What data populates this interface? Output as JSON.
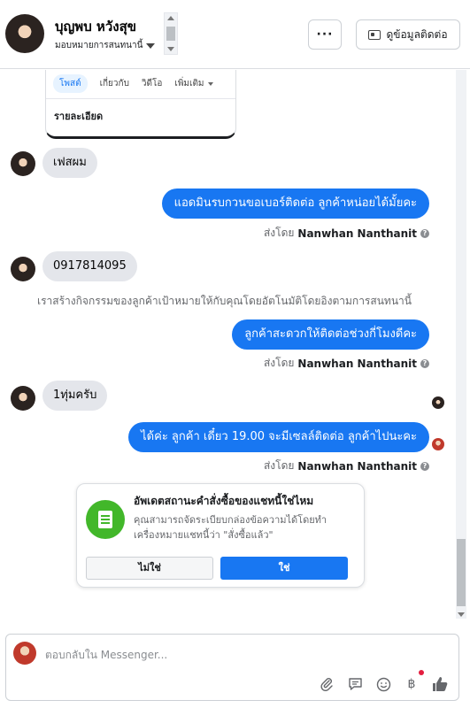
{
  "header": {
    "name": "บุญพบ หวังสุข",
    "assign_label": "มอบหมายการสนทนานี้",
    "more_label": "···",
    "contact_button": "ดูข้อมูลติดต่อ"
  },
  "preview": {
    "tabs": [
      {
        "label": "โพสต์",
        "active": true
      },
      {
        "label": "เกี่ยวกับ",
        "active": false
      },
      {
        "label": "วิดีโอ",
        "active": false
      },
      {
        "label": "เพิ่มเติม",
        "active": false
      }
    ],
    "detail_label": "รายละเอียด"
  },
  "messages": [
    {
      "direction": "in",
      "text": "เฟสผม"
    },
    {
      "direction": "out",
      "text": "แอดมินรบกวนขอเบอร์ติดต่อ ลูกค้าหน่อยได้มั้ยคะ"
    },
    {
      "direction": "in",
      "text": "0917814095"
    },
    {
      "direction": "out",
      "text": "ลูกค้าสะดวกให้ติดต่อช่วงกี่โมงดีคะ"
    },
    {
      "direction": "in",
      "text": "1ทุ่มครับ"
    },
    {
      "direction": "out",
      "text": "ได้ค่ะ ลูกค้า เดี๋ยว 19.00 จะมีเซลล์ติดต่อ ลูกค้าไปนะคะ"
    }
  ],
  "sent_by": {
    "prefix": "ส่งโดย",
    "name": "Nanwhan Nanthanit"
  },
  "system_note": "เราสร้างกิจกรรมของลูกค้าเป้าหมายให้กับคุณโดยอัตโนมัติโดยอิงตามการสนทนานี้",
  "order_update": {
    "title": "อัพเดตสถานะคำสั่งซื้อของแชทนี้ใช่ไหม",
    "description": "คุณสามารถจัดระเบียบกล่องข้อความได้โดยทำเครื่องหมายแชทนี้ว่า \"สั่งซื้อแล้ว\"",
    "no_label": "ไม่ใช่",
    "yes_label": "ใช่"
  },
  "composer": {
    "placeholder": "ตอบกลับใน Messenger...",
    "icons": [
      "paperclip-icon",
      "saved-reply-icon",
      "emoji-icon",
      "payment-icon",
      "thumbs-up-icon"
    ]
  },
  "colors": {
    "accent": "#1877f2",
    "incoming_bubble": "#e4e6eb",
    "order_icon_bg": "#42b72a"
  }
}
